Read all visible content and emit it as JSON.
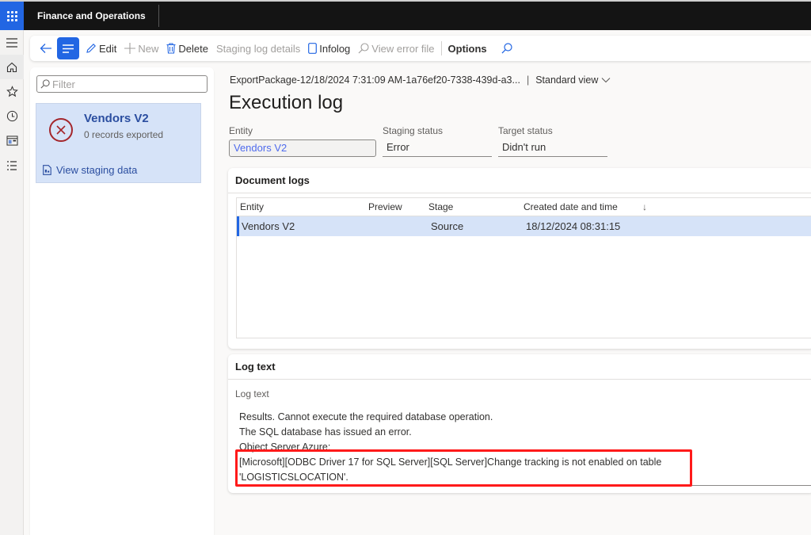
{
  "topbar": {
    "app_title": "Finance and Operations"
  },
  "navrail": {
    "items": [
      {
        "icon": "hamburger-icon",
        "label": "Expand navigation"
      },
      {
        "icon": "home-icon",
        "label": "Home"
      },
      {
        "icon": "star-icon",
        "label": "Favorites"
      },
      {
        "icon": "clock-icon",
        "label": "Recent"
      },
      {
        "icon": "workspace-icon",
        "label": "Workspaces"
      },
      {
        "icon": "list-icon",
        "label": "Modules"
      }
    ]
  },
  "actionbar": {
    "back_icon": "back-arrow-icon",
    "menu_icon": "action-menu-icon",
    "edit": "Edit",
    "new": "New",
    "delete": "Delete",
    "staging_log_details": "Staging log details",
    "infolog": "Infolog",
    "view_error_file": "View error file",
    "options": "Options",
    "search_icon": "search-icon"
  },
  "leftpanel": {
    "filter_placeholder": "Filter",
    "card": {
      "title": "Vendors V2",
      "subtitle": "0 records exported",
      "status_icon": "error-circle-icon",
      "link": "View staging data"
    }
  },
  "content": {
    "breadcrumb": "ExportPackage-12/18/2024 7:31:09 AM-1a76ef20-7338-439d-a3...",
    "breadcrumb_sep": "|",
    "view_selector": "Standard view",
    "title": "Execution log",
    "fields": {
      "entity": {
        "label": "Entity",
        "value": "Vendors V2"
      },
      "staging_status": {
        "label": "Staging status",
        "value": "Error"
      },
      "target_status": {
        "label": "Target status",
        "value": "Didn't run"
      }
    },
    "document_logs": {
      "header": "Document logs",
      "columns": [
        "Entity",
        "Preview",
        "Stage",
        "Created date and time"
      ],
      "sort_indicator": "↓",
      "rows": [
        {
          "entity": "Vendors V2",
          "preview": "",
          "stage": "Source",
          "created": "18/12/2024 08:31:15"
        }
      ]
    },
    "log_text": {
      "header": "Log text",
      "label": "Log text",
      "lines": [
        "Results. Cannot execute the required database operation.",
        "The SQL database has issued an error.",
        "Object Server Azure:",
        "[Microsoft][ODBC Driver 17 for SQL Server][SQL Server]Change tracking is not enabled on table",
        "'LOGISTICSLOCATION'."
      ],
      "highlight_color": "#ff1a1a"
    }
  },
  "colors": {
    "accent": "#2266e3",
    "topbar": "#141414",
    "selection": "#d6e3f8",
    "error": "#a4262c"
  }
}
